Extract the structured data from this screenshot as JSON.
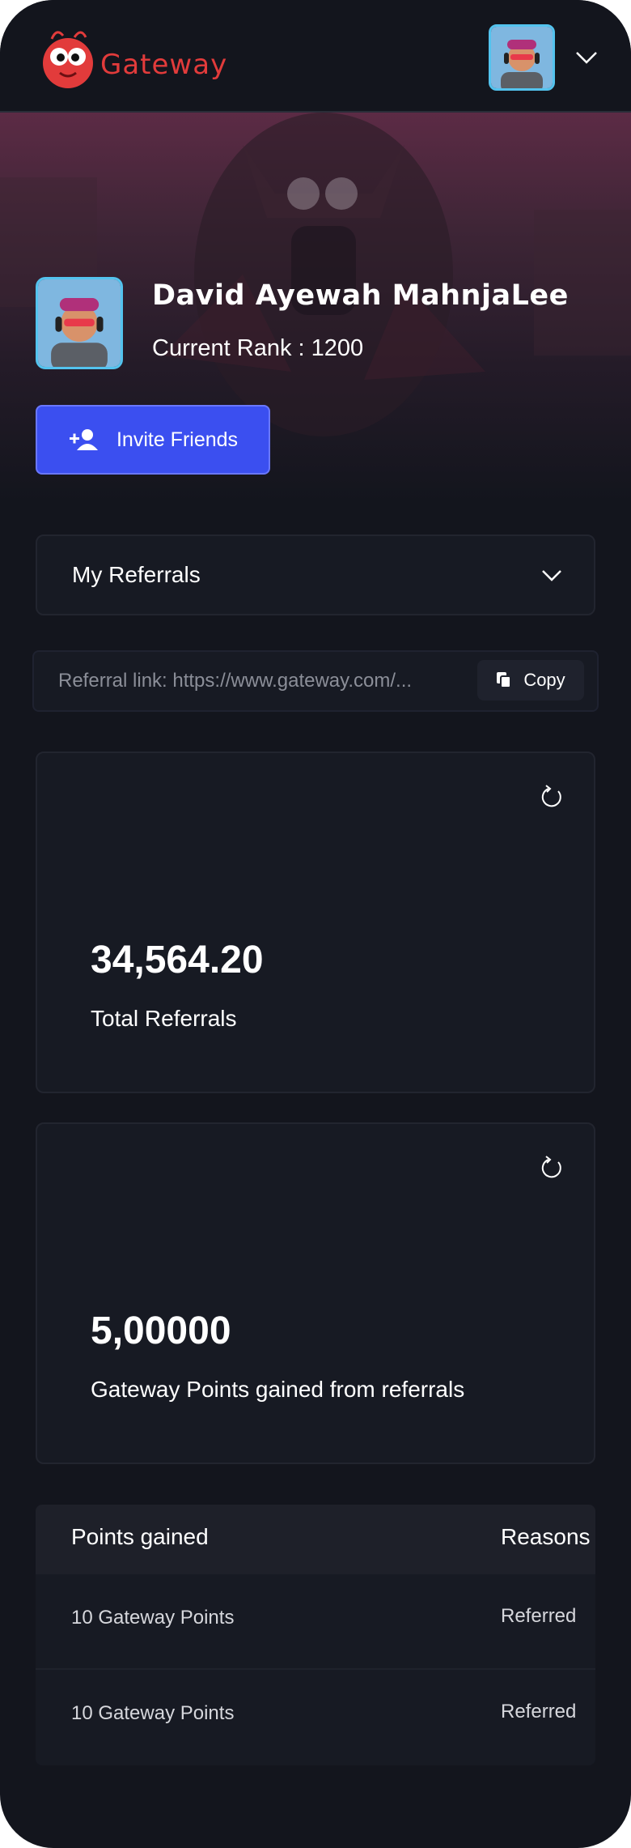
{
  "header": {
    "brand": "Gateway",
    "logo_icon": "red-mascot-logo-icon",
    "account_icon": "chevron-down-icon"
  },
  "profile": {
    "name": "David Ayewah MahnjaLee",
    "rank": "Current Rank : 1200",
    "invite_label": "Invite Friends"
  },
  "referrals": {
    "dropdown_label": "My Referrals",
    "link_text": "Referral link: https://www.gateway.com/...",
    "copy_label": "Copy"
  },
  "stats": [
    {
      "value": "34,564.20",
      "caption": "Total Referrals"
    },
    {
      "value": "5,00000",
      "caption": "Gateway Points gained from referrals"
    }
  ],
  "table": {
    "headers": [
      "Points gained",
      "Reasons"
    ],
    "rows": [
      [
        "10 Gateway Points",
        "Referred"
      ],
      [
        "10 Gateway Points",
        "Referred"
      ]
    ]
  },
  "colors": {
    "background": "#13151d",
    "card": "#171a23",
    "accent_blue": "#3b4ff0",
    "brand_red": "#e23b3b",
    "avatar_border": "#53c3ee"
  }
}
